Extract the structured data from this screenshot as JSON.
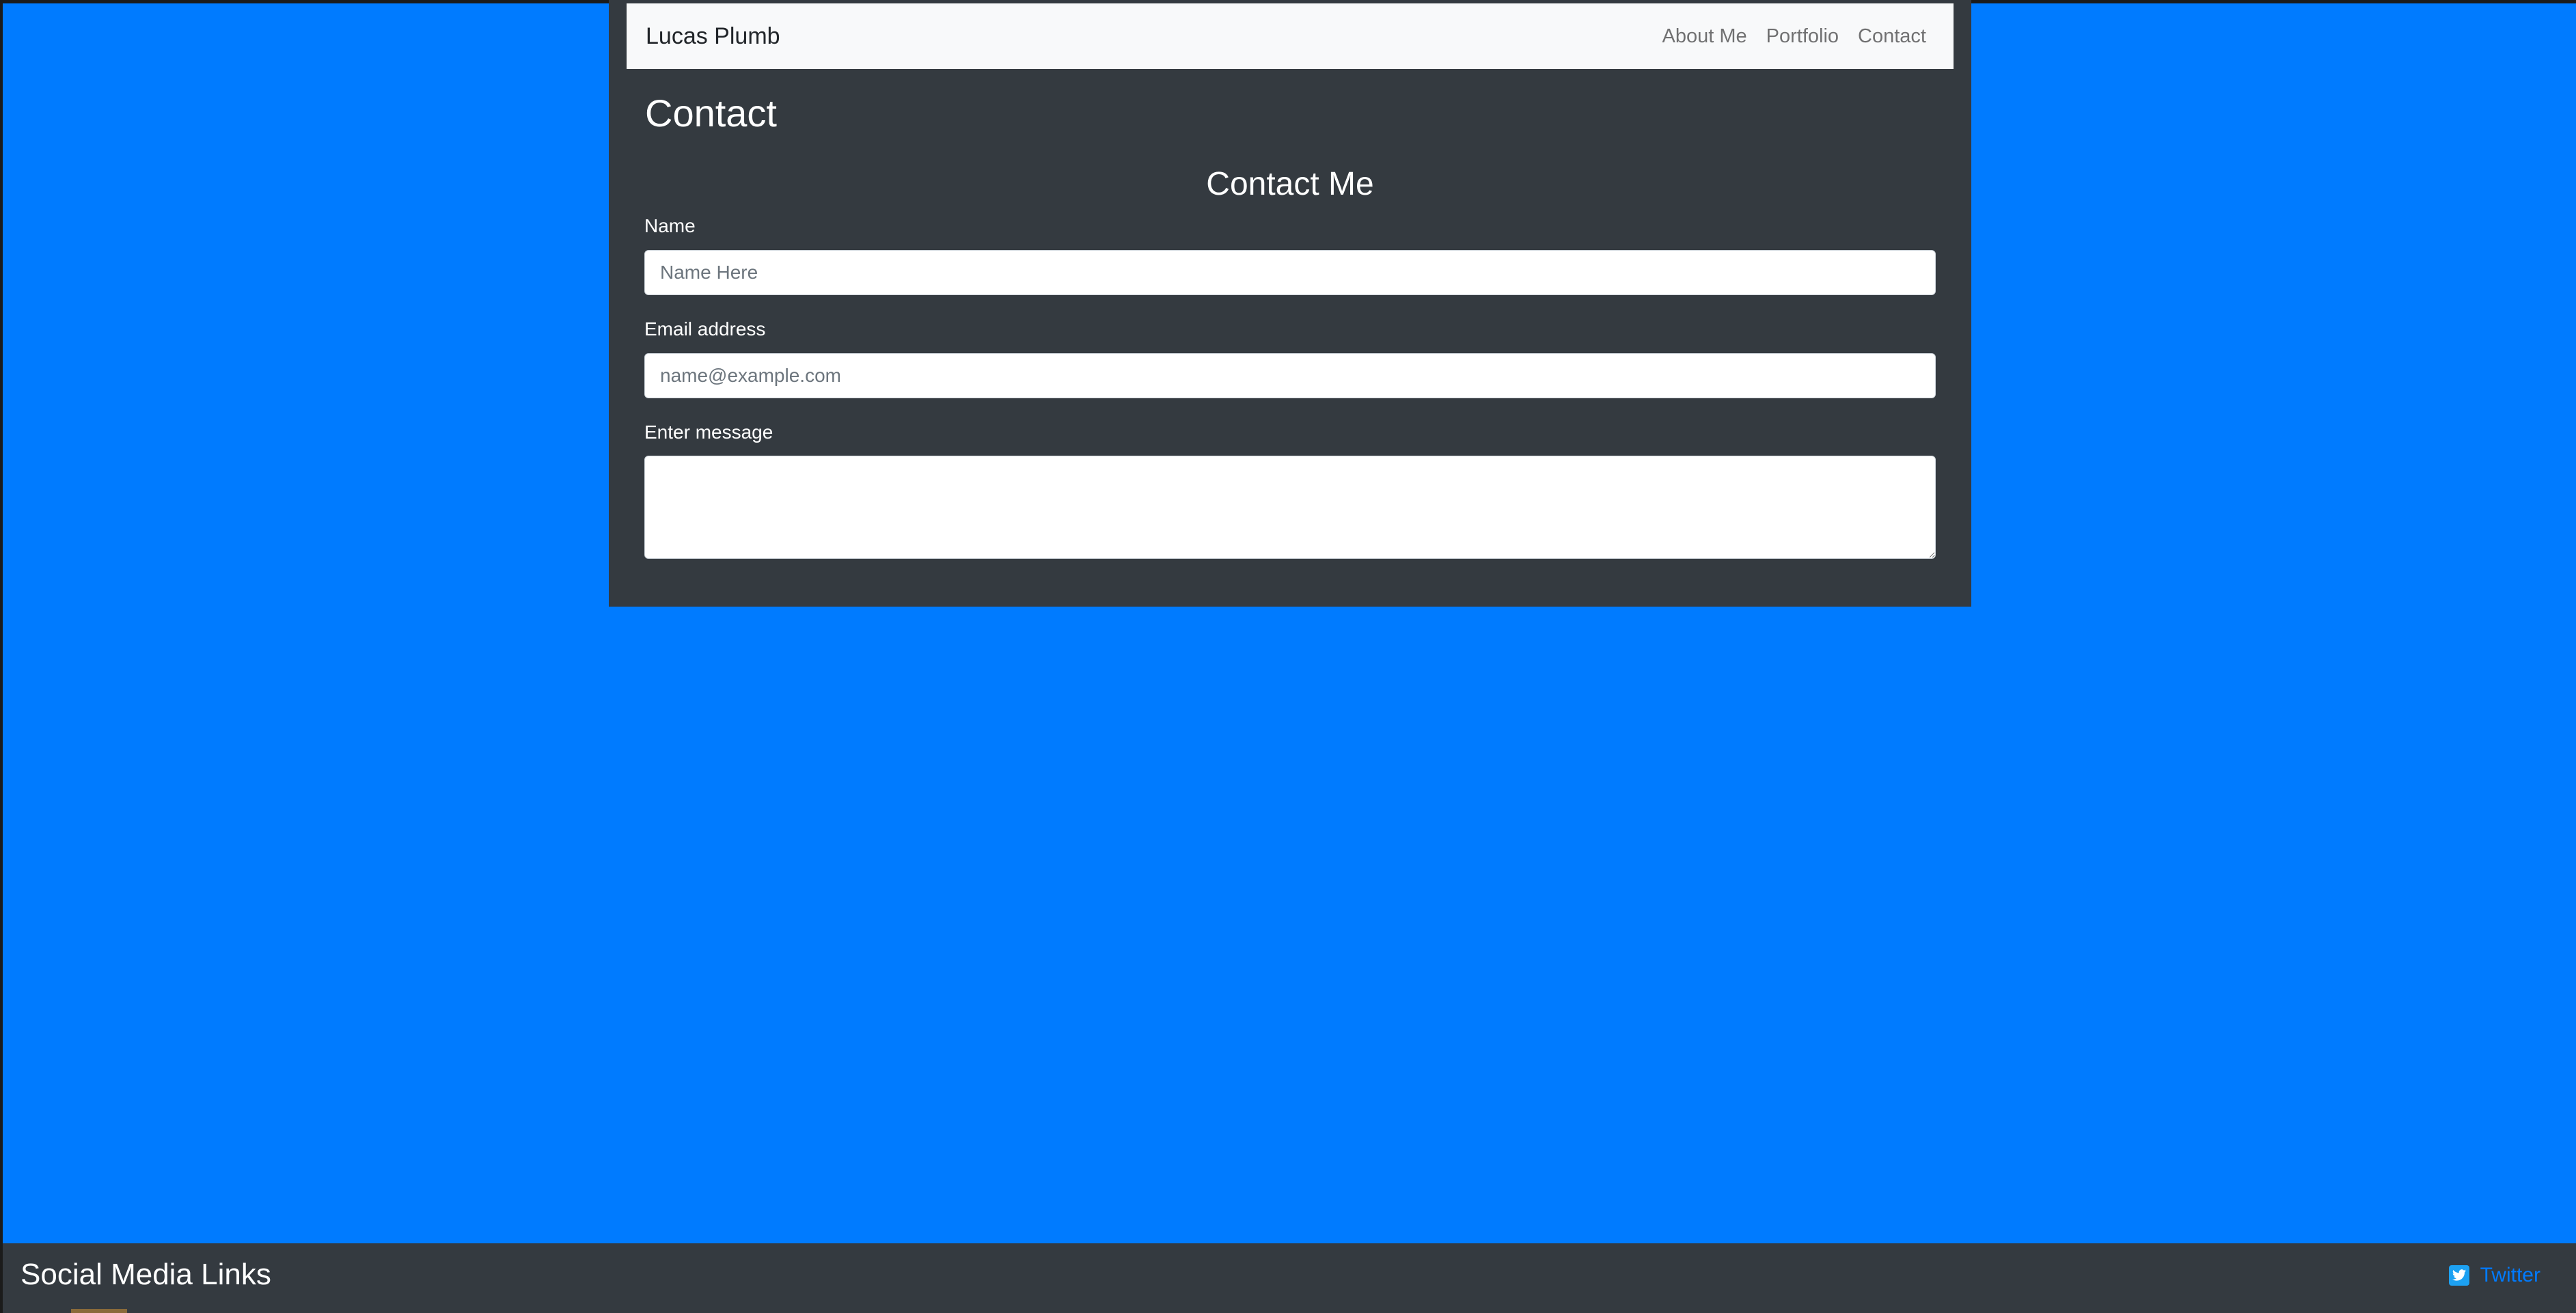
{
  "colors": {
    "page_background": "#007bff",
    "panel_background": "#343a40",
    "navbar_background": "#f8f9fa",
    "link_color": "#007bff",
    "twitter_blue": "#1da1f2"
  },
  "navbar": {
    "brand": "Lucas Plumb",
    "links": [
      {
        "label": "About Me"
      },
      {
        "label": "Portfolio"
      },
      {
        "label": "Contact"
      }
    ]
  },
  "main": {
    "page_title": "Contact",
    "form": {
      "title": "Contact Me",
      "name_label": "Name",
      "name_placeholder": "Name Here",
      "name_value": "",
      "email_label": "Email address",
      "email_placeholder": "name@example.com",
      "email_value": "",
      "message_label": "Enter message",
      "message_value": ""
    }
  },
  "footer": {
    "title": "Social Media Links",
    "social_links": [
      {
        "label": "Twitter",
        "icon": "twitter-icon"
      }
    ]
  }
}
